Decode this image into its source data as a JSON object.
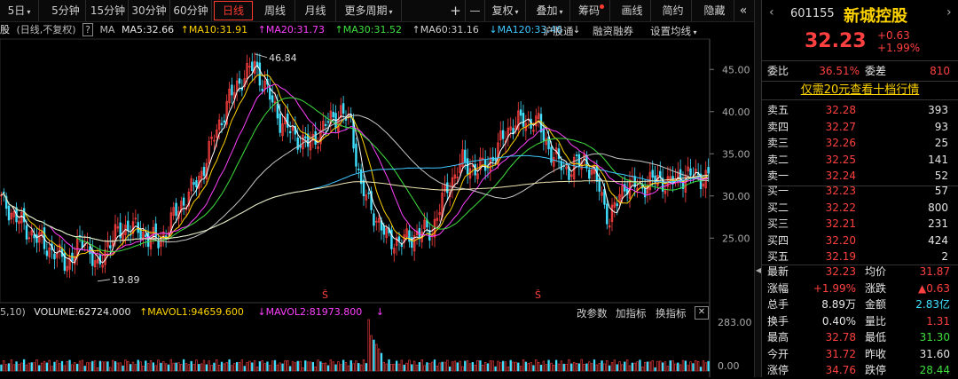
{
  "toolbar": {
    "periods": [
      {
        "label": "5日",
        "dropdown": true
      },
      {
        "label": "5分钟",
        "dropdown": false
      },
      {
        "label": "15分钟",
        "dropdown": false
      },
      {
        "label": "30分钟",
        "dropdown": false
      },
      {
        "label": "60分钟",
        "dropdown": false
      },
      {
        "label": "日线",
        "dropdown": false,
        "active": true
      },
      {
        "label": "周线",
        "dropdown": false
      },
      {
        "label": "月线",
        "dropdown": false
      },
      {
        "label": "更多周期",
        "dropdown": true
      }
    ],
    "plus": "+",
    "minus": "—",
    "fuquan": "复权",
    "diejia": "叠加",
    "chouma": "筹码",
    "huaxian": "画线",
    "jianyue": "简约",
    "yincang": "隐藏"
  },
  "ma_row": {
    "prefix": "股",
    "mode": "(日线,不复权)",
    "help": "?",
    "ma": "MA",
    "ma5": "MA5:32.66",
    "ma10": "MA10:31.91",
    "ma20": "MA20:31.73",
    "ma30": "MA30:31.52",
    "ma60": "MA60:31.16",
    "ma120": "MA120:33.46",
    "hugutong": "沪股通",
    "rongzi": "融资融券",
    "shezhi": "设置均线"
  },
  "volume_row": {
    "prefix": "5,10)",
    "volume": "VOLUME:62724.000",
    "mavol1": "MAVOL1:94659.600",
    "mavol2": "MAVOL2:81973.800",
    "params": "改参数",
    "add_ind": "加指标",
    "switch_ind": "换指标",
    "close": "✕"
  },
  "colors": {
    "up": "#ff4040",
    "down": "#40e0ff",
    "ma5": "#ffffff",
    "ma10": "#ffd400",
    "ma20": "#ff40ff",
    "ma30": "#3ee03e",
    "ma60": "#c8c8c8",
    "ma120": "#40c8ff",
    "ma250": "#f0e6b4"
  },
  "chart_data": {
    "type": "candlestick",
    "y_ticks": [
      "45.00",
      "40.00",
      "35.00",
      "30.00",
      "25.00"
    ],
    "ylim": [
      18.5,
      48.5
    ],
    "vol_ticks": [
      "283.00",
      "0.00"
    ],
    "annotations": {
      "high": "46.84",
      "low": "19.89"
    },
    "margin_marks": [
      "Ŝ",
      "Ŝ"
    ],
    "approx_points": [
      {
        "i": 0,
        "close": 29.5
      },
      {
        "i": 10,
        "close": 26.0
      },
      {
        "i": 18,
        "close": 24.0
      },
      {
        "i": 26,
        "close": 22.0
      },
      {
        "i": 33,
        "close": 25.0
      },
      {
        "i": 38,
        "close": 21.0
      },
      {
        "i": 42,
        "close": 24.5
      },
      {
        "i": 50,
        "close": 26.5
      },
      {
        "i": 56,
        "close": 25.5
      },
      {
        "i": 62,
        "close": 24.5
      },
      {
        "i": 70,
        "close": 28.5
      },
      {
        "i": 78,
        "close": 32.0
      },
      {
        "i": 84,
        "close": 37.0
      },
      {
        "i": 90,
        "close": 41.5
      },
      {
        "i": 95,
        "close": 44.0
      },
      {
        "i": 100,
        "close": 45.5
      },
      {
        "i": 104,
        "close": 43.0
      },
      {
        "i": 110,
        "close": 39.0
      },
      {
        "i": 116,
        "close": 37.0
      },
      {
        "i": 122,
        "close": 36.0
      },
      {
        "i": 128,
        "close": 38.5
      },
      {
        "i": 134,
        "close": 40.0
      },
      {
        "i": 138,
        "close": 38.5
      },
      {
        "i": 142,
        "close": 31.0
      },
      {
        "i": 146,
        "close": 28.5
      },
      {
        "i": 152,
        "close": 25.0
      },
      {
        "i": 158,
        "close": 24.5
      },
      {
        "i": 164,
        "close": 25.5
      },
      {
        "i": 170,
        "close": 26.0
      },
      {
        "i": 176,
        "close": 31.0
      },
      {
        "i": 182,
        "close": 34.0
      },
      {
        "i": 188,
        "close": 33.0
      },
      {
        "i": 194,
        "close": 34.5
      },
      {
        "i": 200,
        "close": 38.0
      },
      {
        "i": 206,
        "close": 39.0
      },
      {
        "i": 212,
        "close": 38.5
      },
      {
        "i": 218,
        "close": 34.5
      },
      {
        "i": 224,
        "close": 33.0
      },
      {
        "i": 230,
        "close": 34.5
      },
      {
        "i": 236,
        "close": 31.0
      },
      {
        "i": 240,
        "close": 27.0
      },
      {
        "i": 246,
        "close": 31.5
      },
      {
        "i": 252,
        "close": 31.0
      },
      {
        "i": 258,
        "close": 32.0
      },
      {
        "i": 264,
        "close": 31.5
      },
      {
        "i": 270,
        "close": 32.5
      },
      {
        "i": 276,
        "close": 32.23
      }
    ]
  },
  "quote": {
    "code": "601155",
    "name": "新城控股",
    "price": "32.23",
    "change": "+0.63",
    "change_pct": "+1.99%",
    "weibi_label": "委比",
    "weibi": "36.51%",
    "weicha_label": "委差",
    "weicha": "810",
    "ten_level": "仅需20元查看十档行情",
    "asks": [
      {
        "label": "卖五",
        "price": "32.28",
        "vol": "393"
      },
      {
        "label": "卖四",
        "price": "32.27",
        "vol": "93"
      },
      {
        "label": "卖三",
        "price": "32.26",
        "vol": "25"
      },
      {
        "label": "卖二",
        "price": "32.25",
        "vol": "141"
      },
      {
        "label": "卖一",
        "price": "32.24",
        "vol": "52"
      }
    ],
    "bids": [
      {
        "label": "买一",
        "price": "32.23",
        "vol": "57"
      },
      {
        "label": "买二",
        "price": "32.22",
        "vol": "800"
      },
      {
        "label": "买三",
        "price": "32.21",
        "vol": "231"
      },
      {
        "label": "买四",
        "price": "32.20",
        "vol": "424"
      },
      {
        "label": "买五",
        "price": "32.19",
        "vol": "2"
      }
    ],
    "stats": [
      {
        "l1": "最新",
        "v1": "32.23",
        "c1": "red",
        "l2": "均价",
        "v2": "31.87",
        "c2": "red"
      },
      {
        "l1": "涨幅",
        "v1": "+1.99%",
        "c1": "red",
        "l2": "涨跌",
        "v2": "▲0.63",
        "c2": "red"
      },
      {
        "l1": "总手",
        "v1": "8.89万",
        "c1": "white",
        "l2": "金额",
        "v2": "2.83亿",
        "c2": "cyan"
      },
      {
        "l1": "换手",
        "v1": "0.40%",
        "c1": "white",
        "l2": "量比",
        "v2": "1.31",
        "c2": "red"
      },
      {
        "l1": "最高",
        "v1": "32.78",
        "c1": "red",
        "l2": "最低",
        "v2": "31.30",
        "c2": "green"
      },
      {
        "l1": "今开",
        "v1": "31.72",
        "c1": "red",
        "l2": "昨收",
        "v2": "31.60",
        "c2": "white"
      },
      {
        "l1": "涨停",
        "v1": "34.76",
        "c1": "red",
        "l2": "跌停",
        "v2": "28.44",
        "c2": "green"
      }
    ]
  }
}
